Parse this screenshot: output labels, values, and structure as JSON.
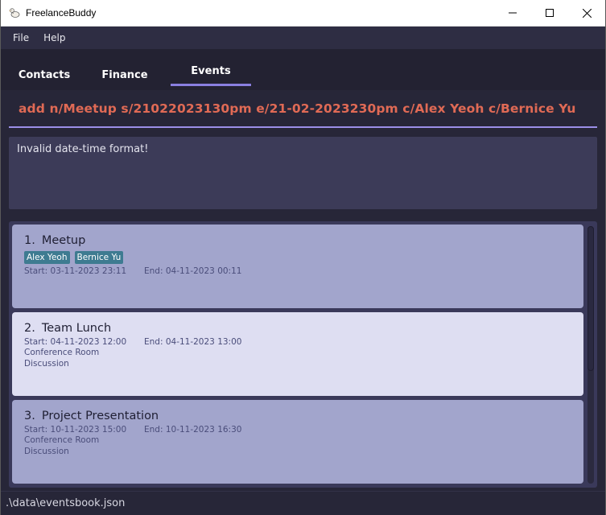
{
  "window": {
    "title": "FreelanceBuddy",
    "controls": {
      "minimize": "minimize-icon",
      "maximize": "maximize-icon",
      "close": "close-icon"
    }
  },
  "menu": {
    "items": [
      {
        "label": "File"
      },
      {
        "label": "Help"
      }
    ]
  },
  "tabs": [
    {
      "label": "Contacts",
      "active": false
    },
    {
      "label": "Finance",
      "active": false
    },
    {
      "label": "Events",
      "active": true
    }
  ],
  "command": {
    "value": "add n/Meetup s/21022023130pm e/21-02-2023230pm c/Alex Yeoh c/Bernice Yu"
  },
  "result": {
    "message": "Invalid date-time format!"
  },
  "events": [
    {
      "index": "1.",
      "name": "Meetup",
      "tags": [
        "Alex Yeoh",
        "Bernice Yu"
      ],
      "start": "Start: 03-11-2023 23:11",
      "end": "End: 04-11-2023 00:11",
      "details": []
    },
    {
      "index": "2.",
      "name": "Team Lunch",
      "tags": [],
      "start": "Start: 04-11-2023 12:00",
      "end": "End: 04-11-2023 13:00",
      "details": [
        "Conference Room",
        "Discussion"
      ]
    },
    {
      "index": "3.",
      "name": "Project Presentation",
      "tags": [],
      "start": "Start: 10-11-2023 15:00",
      "end": "End: 10-11-2023 16:30",
      "details": [
        "Conference Room",
        "Discussion"
      ]
    }
  ],
  "status": {
    "path": ".\\data\\eventsbook.json"
  },
  "colors": {
    "accent": "#8a7fe0",
    "command_text": "#e06a55",
    "tag": "#3e7b91",
    "card_odd": "#a2a5cc",
    "card_even": "#dedef2"
  }
}
